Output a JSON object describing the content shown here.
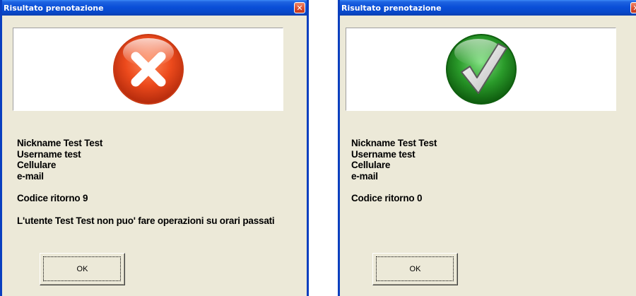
{
  "colors": {
    "titlebar": "#0a4fd8",
    "window_bg": "#ece9d8",
    "error_icon": "#e8441a",
    "success_icon": "#1f8a1f"
  },
  "windows": [
    {
      "title": "Risultato prenotazione",
      "icon": "error-x-icon",
      "nickname": "Nickname Test Test",
      "username": "Username test",
      "cellulare": "Cellulare",
      "email": "e-mail",
      "codice": "Codice ritorno 9",
      "message": "L'utente Test Test non puo' fare operazioni su orari passati",
      "ok_label": "OK"
    },
    {
      "title": "Risultato prenotazione",
      "icon": "success-check-icon",
      "nickname": "Nickname Test Test",
      "username": "Username test",
      "cellulare": "Cellulare",
      "email": "e-mail",
      "codice": "Codice ritorno 0",
      "ok_label": "OK"
    }
  ]
}
